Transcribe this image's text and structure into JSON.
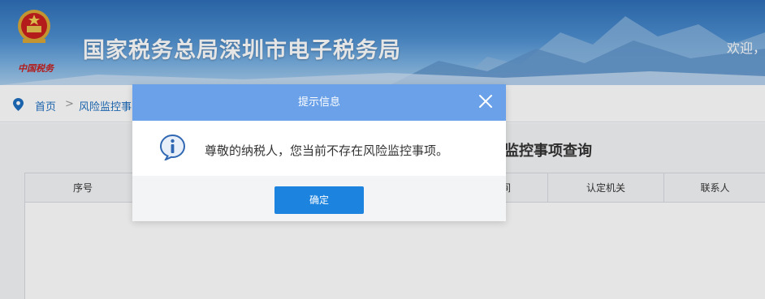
{
  "header": {
    "site_title": "国家税务总局深圳市电子税务局",
    "tax_mark": "中国税务",
    "welcome": "欢迎，"
  },
  "breadcrumb": {
    "home": "首页",
    "separator": ">",
    "current": "风险监控事"
  },
  "main": {
    "page_title": "险监控事项查询",
    "table_headers": {
      "seq": "序号",
      "date": "间",
      "org": "认定机关",
      "contact": "联系人"
    }
  },
  "dialog": {
    "title": "提示信息",
    "message": "尊敬的纳税人，您当前不存在风险监控事项。",
    "ok_label": "确定"
  },
  "colors": {
    "header_blue": "#2f6fb8",
    "dialog_head": "#6aa1e9",
    "button_blue": "#1c83de",
    "link_blue": "#1e6fc0"
  },
  "icons": [
    "national-emblem-icon",
    "location-pin-icon",
    "close-icon",
    "info-icon"
  ]
}
